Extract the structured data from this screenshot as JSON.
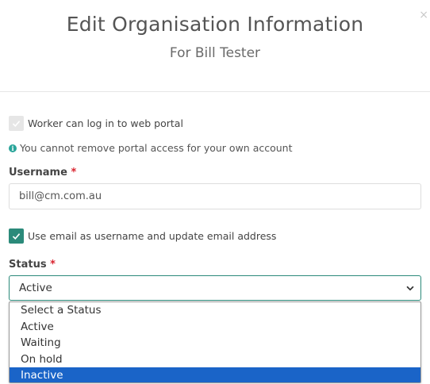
{
  "modal": {
    "title": "Edit Organisation Information",
    "subtitle": "For Bill Tester",
    "close_symbol": "×"
  },
  "portal_access": {
    "label": "Worker can log in to web portal",
    "checked": true,
    "disabled": true,
    "info_icon": "info-circle-icon",
    "info_text": "You cannot remove portal access for your own account"
  },
  "username": {
    "label": "Username",
    "required_marker": "*",
    "value": "bill@cm.com.au"
  },
  "use_email": {
    "label": "Use email as username and update email address",
    "checked": true
  },
  "status": {
    "label": "Status",
    "required_marker": "*",
    "selected": "Active",
    "options": [
      "Select a Status",
      "Active",
      "Waiting",
      "On hold",
      "Inactive"
    ],
    "highlighted": "Inactive"
  },
  "colors": {
    "accent": "#2b8a7a",
    "highlight": "#1a64c8",
    "required": "#d9242f"
  }
}
